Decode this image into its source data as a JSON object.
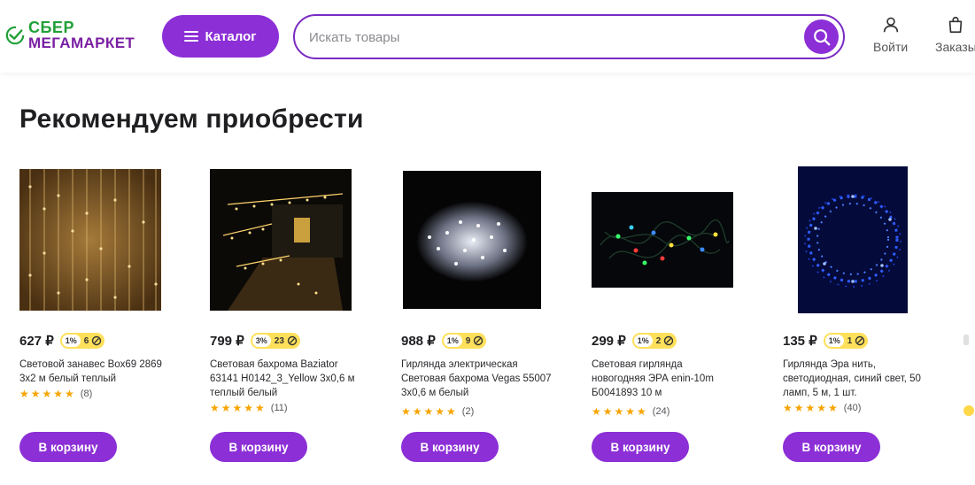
{
  "header": {
    "logo_line1": "СБЕР",
    "logo_line2": "МЕГАМАРКЕТ",
    "catalog_label": "Каталог",
    "search_placeholder": "Искать товары",
    "login_label": "Войти",
    "orders_label": "Заказы",
    "icons": [
      "menu-icon",
      "search-icon",
      "user-icon",
      "bag-icon"
    ],
    "colors": {
      "brand_purple": "#8c2fd6",
      "sber_green": "#21a038",
      "bonus_yellow": "#ffe05a",
      "star": "#f7a400"
    }
  },
  "section_title": "Рекомендуем приобрести",
  "products": [
    {
      "price": "627 ₽",
      "bonus_percent": "1%",
      "bonus_points": "6",
      "name": "Световой занавес Box69 2869 3x2 м белый теплый",
      "rating_count": "(8)",
      "stars": 5,
      "cart_label": "В корзину",
      "image": "warm-white-curtain-lights"
    },
    {
      "price": "799 ₽",
      "bonus_percent": "3%",
      "bonus_points": "23",
      "name": "Световая бахрома Baziator 63141 H0142_3_Yellow 3x0,6 м теплый белый",
      "rating_count": "(11)",
      "stars": 5,
      "cart_label": "В корзину",
      "image": "house-fringe-lights"
    },
    {
      "price": "988 ₽",
      "bonus_percent": "1%",
      "bonus_points": "9",
      "name": "Гирлянда электрическая Световая бахрома Vegas 55007 3x0,6 м белый",
      "rating_count": "(2)",
      "stars": 5,
      "cart_label": "В корзину",
      "image": "white-led-bundle"
    },
    {
      "price": "299 ₽",
      "bonus_percent": "1%",
      "bonus_points": "2",
      "name": "Световая гирлянда новогодняя ЭРА enin-10m Б0041893 10 м",
      "rating_count": "(24)",
      "stars": 5,
      "cart_label": "В корзину",
      "image": "multicolor-led-garland"
    },
    {
      "price": "135 ₽",
      "bonus_percent": "1%",
      "bonus_points": "1",
      "name": "Гирлянда Эра нить, светодиодная, синий свет, 50 ламп, 5 м, 1 шт.",
      "rating_count": "(40)",
      "stars": 5,
      "cart_label": "В корзину",
      "image": "blue-wire-lights"
    }
  ]
}
